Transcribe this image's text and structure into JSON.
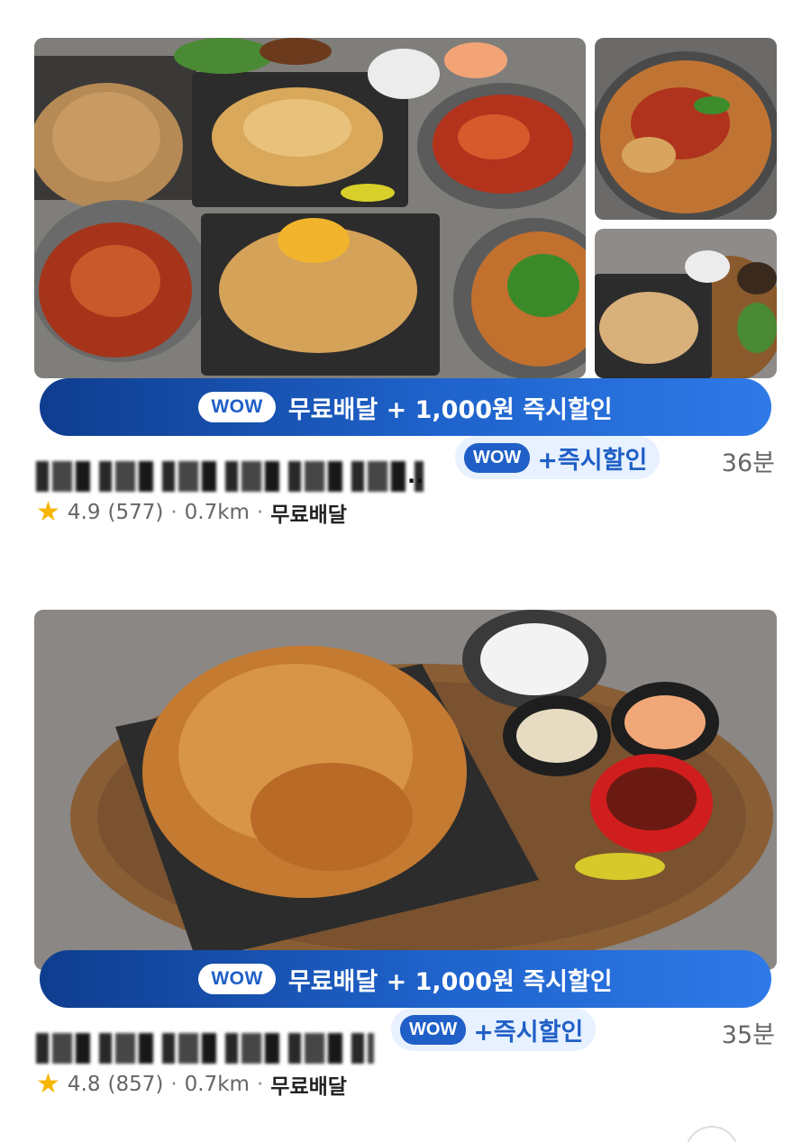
{
  "restaurants": [
    {
      "promo": {
        "wow": "WOW",
        "text": "무료배달 + 1,000원 즉시할인"
      },
      "name_suffix": "..",
      "chip": {
        "wow": "WOW",
        "text": "+즉시할인"
      },
      "time": "36분",
      "rating": "4.9",
      "reviews": "(577)",
      "distance": "0.7km",
      "delivery": "무료배달"
    },
    {
      "promo": {
        "wow": "WOW",
        "text": "무료배달 + 1,000원 즉시할인"
      },
      "chip": {
        "wow": "WOW",
        "text": "+즉시할인"
      },
      "time": "35분",
      "rating": "4.8",
      "reviews": "(857)",
      "distance": "0.7km",
      "delivery": "무료배달"
    }
  ],
  "separator": "·",
  "colors": {
    "accent": "#1f5fc7",
    "promo_gradient_start": "#0f3d8f",
    "star": "#f7b500",
    "chip_bg": "#e7f1ff"
  },
  "icons": {
    "star": "star-icon"
  }
}
